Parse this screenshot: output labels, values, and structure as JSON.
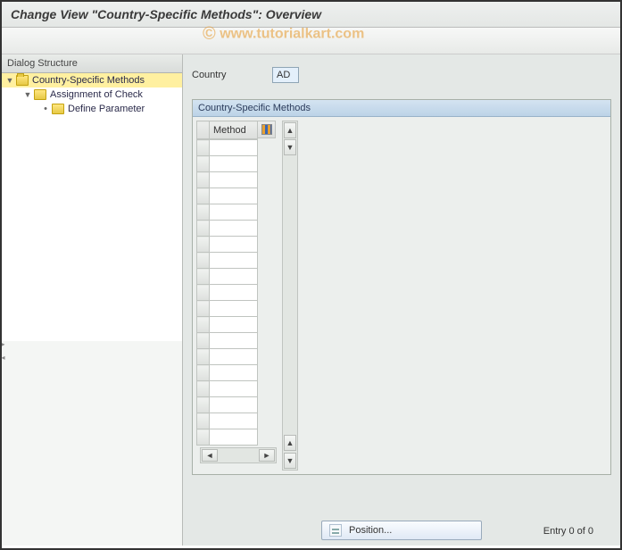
{
  "title": "Change View \"Country-Specific Methods\": Overview",
  "watermark": "www.tutorialkart.com",
  "sidebar": {
    "header": "Dialog Structure",
    "items": [
      {
        "label": "Country-Specific Methods",
        "selected": true
      },
      {
        "label": "Assignment of Check",
        "selected": false
      },
      {
        "label": "Define Parameter",
        "selected": false
      }
    ]
  },
  "form": {
    "country_label": "Country",
    "country_value": "AD"
  },
  "panel": {
    "title": "Country-Specific Methods",
    "column_header": "Method",
    "rows": 19
  },
  "footer": {
    "position_label": "Position...",
    "entry_text": "Entry 0 of 0"
  }
}
